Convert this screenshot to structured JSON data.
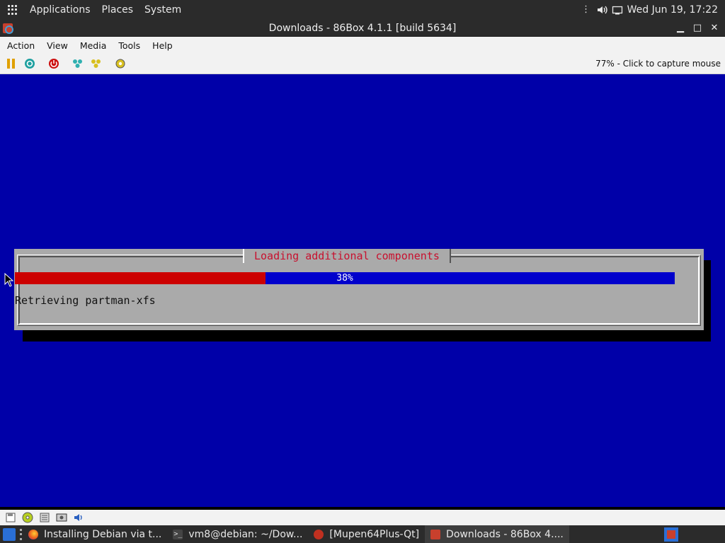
{
  "top_panel": {
    "menus": [
      "Applications",
      "Places",
      "System"
    ],
    "clock": "Wed Jun 19, 17:22"
  },
  "window": {
    "title": "Downloads - 86Box 4.1.1 [build 5634]"
  },
  "menubar": {
    "items": [
      {
        "label": "Action",
        "accel": "A"
      },
      {
        "label": "View",
        "accel": "V"
      },
      {
        "label": "Media",
        "accel": "M"
      },
      {
        "label": "Tools",
        "accel": "T"
      },
      {
        "label": "Help",
        "accel": "H"
      }
    ]
  },
  "toolbar": {
    "buttons": [
      "pause-icon",
      "reset-icon",
      "power-icon",
      "ctrl-alt-del-icon",
      "ctrl-alt-esc-icon",
      "settings-icon"
    ],
    "status_text": "77% - Click to capture mouse"
  },
  "installer": {
    "dialog_title": "Loading additional components",
    "progress_percent": 38,
    "progress_label": "38%",
    "status_line": "Retrieving partman-xfs",
    "colors": {
      "background": "#0000a8",
      "dialog": "#aaaaaa",
      "title": "#c8102e",
      "bar_fill": "#cc0000",
      "bar_track": "#0000cc"
    }
  },
  "statusbar": {
    "icons": [
      "floppy-icon",
      "cdrom-icon",
      "network-icon",
      "hdd-icon",
      "sound-icon"
    ]
  },
  "taskbar": {
    "tasks": [
      {
        "label": "Installing Debian via t...",
        "icon": "firefox-icon",
        "active": false
      },
      {
        "label": "vm8@debian: ~/Dow...",
        "icon": "terminal-icon",
        "active": false
      },
      {
        "label": "[Mupen64Plus-Qt]",
        "icon": "mupen-icon",
        "active": false
      },
      {
        "label": "Downloads - 86Box 4....",
        "icon": "86box-icon",
        "active": true
      }
    ]
  }
}
